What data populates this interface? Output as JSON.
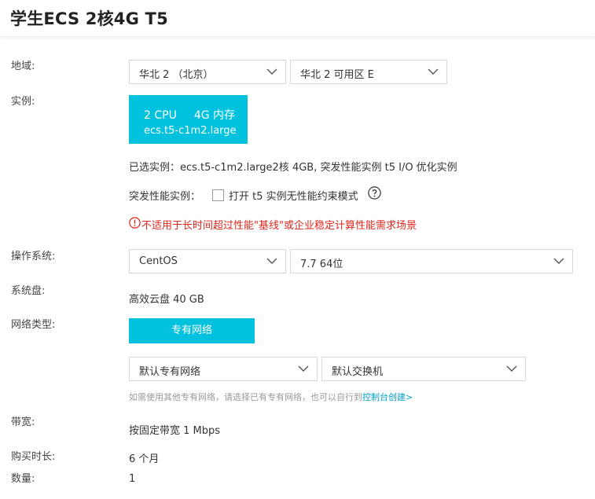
{
  "header": {
    "title": "学生ECS 2核4G T5"
  },
  "region": {
    "label": "地域:",
    "region_value": "华北 2 （北京）",
    "zone_value": "华北 2 可用区 E"
  },
  "instance": {
    "label": "实例:",
    "cpu": "2 CPU",
    "memory": "4G 内存",
    "type": "ecs.t5-c1m2.large",
    "selected_text": "已选实例：ecs.t5-c1m2.large2核 4GB, 突发性能实例 t5 I/O 优化实例",
    "burst_label": "突发性能实例：",
    "burst_option": "打开 t5 实例无性能约束模式",
    "warning": "不适用于长时间超过性能\"基线\"或企业稳定计算性能需求场景",
    "warning_color": "#e0271e"
  },
  "os": {
    "label": "操作系统:",
    "os_value": "CentOS",
    "version_value": "7.7 64位"
  },
  "disk": {
    "label": "系统盘:",
    "value": "高效云盘 40 GB"
  },
  "network": {
    "label": "网络类型:",
    "button": "专有网络",
    "vpc_value": "默认专有网络",
    "vswitch_value": "默认交换机",
    "hint_text": "如需使用其他专有网络，请选择已有专有网络，也可以自行到",
    "hint_link": "控制台创建>"
  },
  "bandwidth": {
    "label": "带宽:",
    "value": "按固定带宽 1 Mbps"
  },
  "duration": {
    "label": "购买时长:",
    "value": "6 个月"
  },
  "quantity": {
    "label": "数量:",
    "value": "1"
  },
  "colors": {
    "accent": "#00c1de",
    "link": "#00a2ca"
  }
}
